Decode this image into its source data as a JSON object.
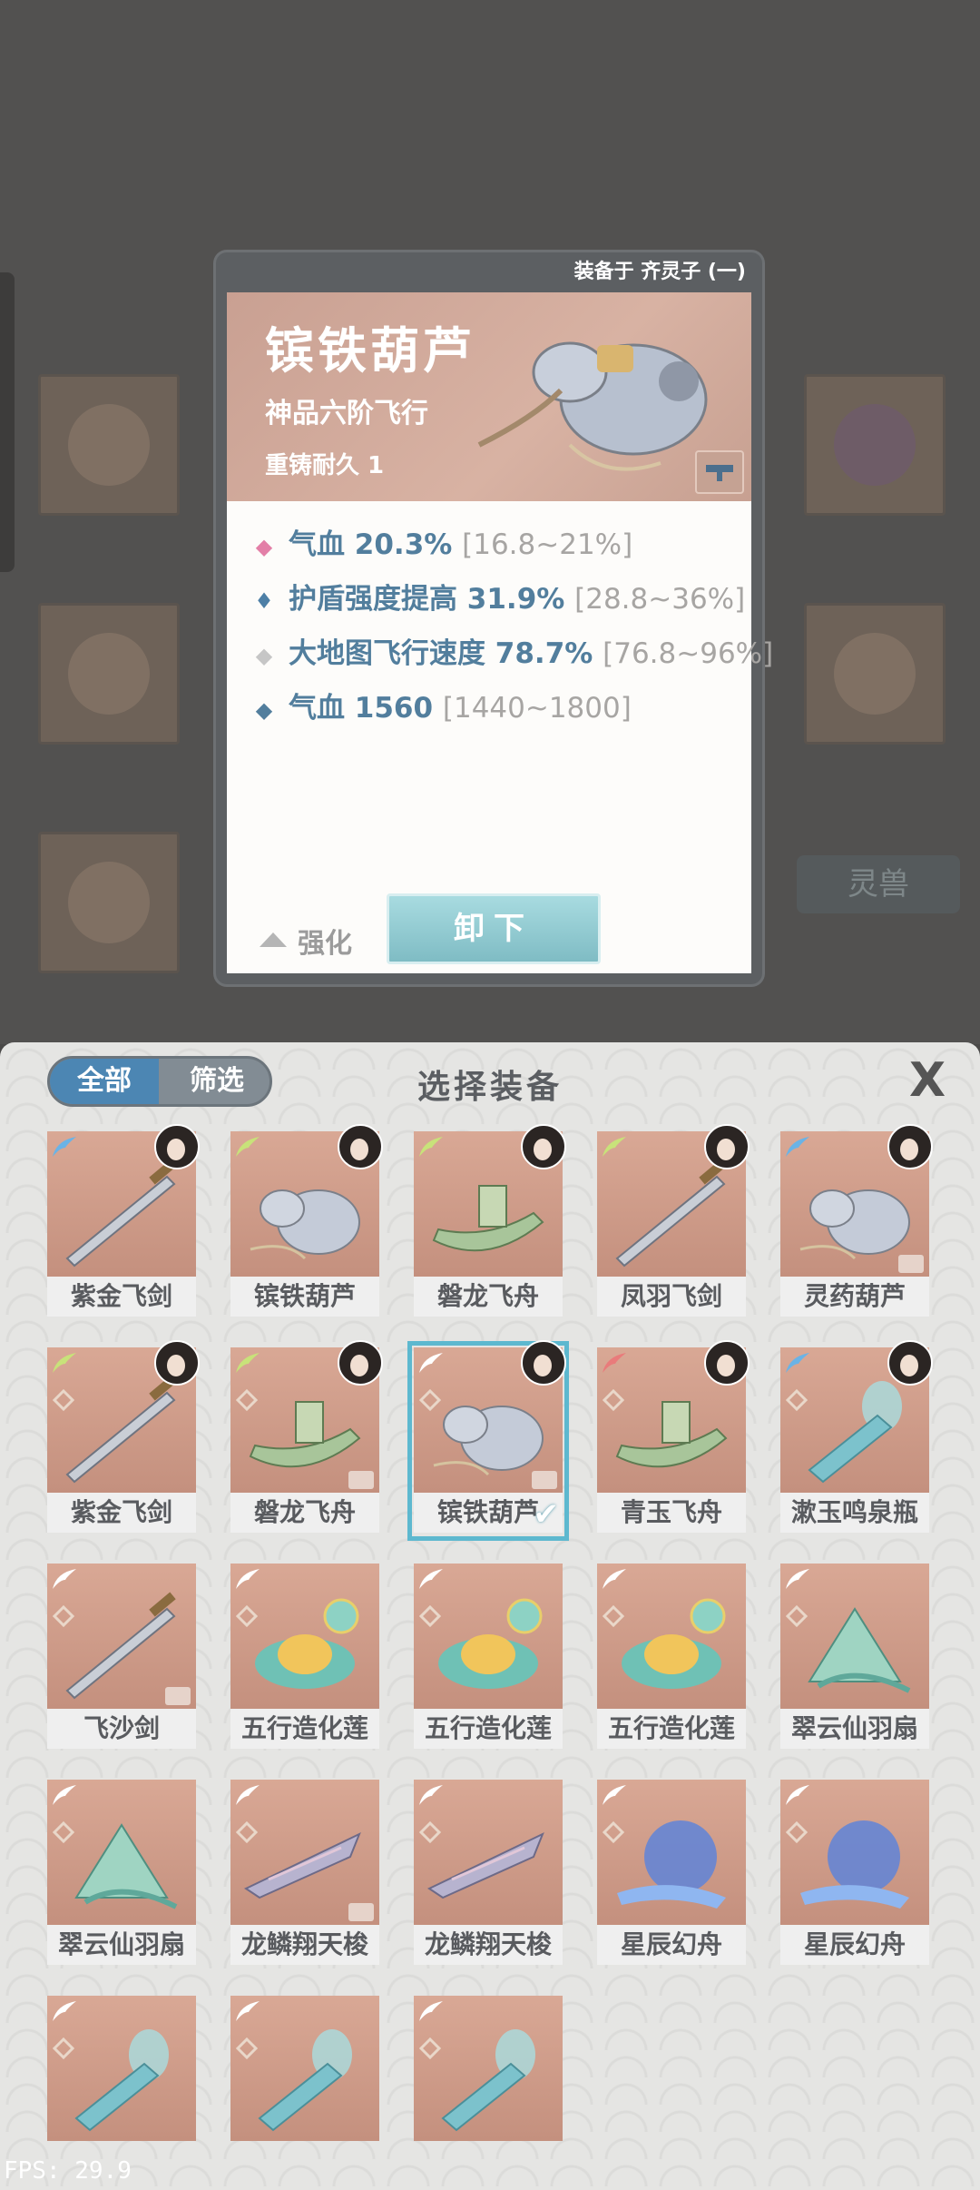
{
  "detail": {
    "equipped_on": "装备于 齐灵子 (一)",
    "name": "镔铁葫芦",
    "grade": "神品六阶飞行",
    "reforge": "重铸耐久 1",
    "stats": [
      {
        "label": "气血 20.3%",
        "range": "[16.8~21%]",
        "marker": "pink-diamond"
      },
      {
        "label": "护盾强度提高 31.9%",
        "range": "[28.8~36%]",
        "marker": "blue-flame"
      },
      {
        "label": "大地图飞行速度 78.7%",
        "range": "[76.8~96%]",
        "marker": "grey-diamond"
      },
      {
        "label": "气血 1560",
        "range": "[1440~1800]",
        "marker": "blue-diamond"
      }
    ],
    "enhance_label": "强化",
    "unequip_label": "卸下"
  },
  "background": {
    "tab_label": "灵兽"
  },
  "panel": {
    "title": "选择装备",
    "tab_all": "全部",
    "tab_filter": "筛选",
    "close": "X"
  },
  "items": [
    {
      "name": "紫金飞剑",
      "wing": "#6ab3e6",
      "kind": "sword"
    },
    {
      "name": "镔铁葫芦",
      "wing": "#c8e27a",
      "kind": "gourd"
    },
    {
      "name": "磐龙飞舟",
      "wing": "#c8e27a",
      "kind": "boat"
    },
    {
      "name": "凤羽飞剑",
      "wing": "#c8e27a",
      "kind": "sword"
    },
    {
      "name": "灵药葫芦",
      "wing": "#6ab3e6",
      "kind": "gourd"
    },
    {
      "name": "紫金飞剑",
      "wing": "#c8e27a",
      "kind": "sword"
    },
    {
      "name": "磐龙飞舟",
      "wing": "#c8e27a",
      "kind": "boat"
    },
    {
      "name": "镔铁葫芦",
      "wing": "#ffffff",
      "kind": "gourd",
      "selected": true
    },
    {
      "name": "青玉飞舟",
      "wing": "#e97b7b",
      "kind": "boat"
    },
    {
      "name": "漱玉鸣泉瓶",
      "wing": "#6ab3e6",
      "kind": "bottle"
    },
    {
      "name": "飞沙剑",
      "wing": "#ffffff",
      "kind": "sword"
    },
    {
      "name": "五行造化莲",
      "wing": "#ffffff",
      "kind": "lotus"
    },
    {
      "name": "五行造化莲",
      "wing": "#ffffff",
      "kind": "lotus"
    },
    {
      "name": "五行造化莲",
      "wing": "#ffffff",
      "kind": "lotus"
    },
    {
      "name": "翠云仙羽扇",
      "wing": "#ffffff",
      "kind": "fan"
    },
    {
      "name": "翠云仙羽扇",
      "wing": "#ffffff",
      "kind": "fan"
    },
    {
      "name": "龙鳞翔天梭",
      "wing": "#ffffff",
      "kind": "shuttle"
    },
    {
      "name": "龙鳞翔天梭",
      "wing": "#ffffff",
      "kind": "shuttle"
    },
    {
      "name": "星辰幻舟",
      "wing": "#ffffff",
      "kind": "star"
    },
    {
      "name": "星辰幻舟",
      "wing": "#ffffff",
      "kind": "star"
    },
    {
      "name": "",
      "wing": "#ffffff",
      "kind": "bottle"
    },
    {
      "name": "",
      "wing": "#ffffff",
      "kind": "bottle"
    },
    {
      "name": "",
      "wing": "#ffffff",
      "kind": "bottle"
    }
  ],
  "fps": "FPS: 29.9"
}
